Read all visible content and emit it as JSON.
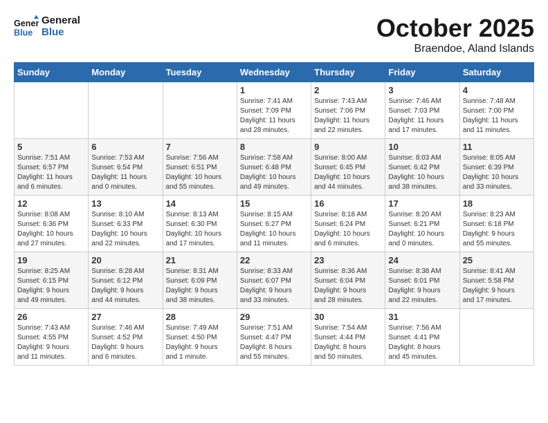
{
  "header": {
    "logo": {
      "line1": "General",
      "line2": "Blue"
    },
    "title": "October 2025",
    "location": "Braendoe, Aland Islands"
  },
  "days_of_week": [
    "Sunday",
    "Monday",
    "Tuesday",
    "Wednesday",
    "Thursday",
    "Friday",
    "Saturday"
  ],
  "weeks": [
    [
      {
        "day": "",
        "content": ""
      },
      {
        "day": "",
        "content": ""
      },
      {
        "day": "",
        "content": ""
      },
      {
        "day": "1",
        "content": "Sunrise: 7:41 AM\nSunset: 7:09 PM\nDaylight: 11 hours\nand 28 minutes."
      },
      {
        "day": "2",
        "content": "Sunrise: 7:43 AM\nSunset: 7:06 PM\nDaylight: 11 hours\nand 22 minutes."
      },
      {
        "day": "3",
        "content": "Sunrise: 7:46 AM\nSunset: 7:03 PM\nDaylight: 11 hours\nand 17 minutes."
      },
      {
        "day": "4",
        "content": "Sunrise: 7:48 AM\nSunset: 7:00 PM\nDaylight: 11 hours\nand 11 minutes."
      }
    ],
    [
      {
        "day": "5",
        "content": "Sunrise: 7:51 AM\nSunset: 6:57 PM\nDaylight: 11 hours\nand 6 minutes."
      },
      {
        "day": "6",
        "content": "Sunrise: 7:53 AM\nSunset: 6:54 PM\nDaylight: 11 hours\nand 0 minutes."
      },
      {
        "day": "7",
        "content": "Sunrise: 7:56 AM\nSunset: 6:51 PM\nDaylight: 10 hours\nand 55 minutes."
      },
      {
        "day": "8",
        "content": "Sunrise: 7:58 AM\nSunset: 6:48 PM\nDaylight: 10 hours\nand 49 minutes."
      },
      {
        "day": "9",
        "content": "Sunrise: 8:00 AM\nSunset: 6:45 PM\nDaylight: 10 hours\nand 44 minutes."
      },
      {
        "day": "10",
        "content": "Sunrise: 8:03 AM\nSunset: 6:42 PM\nDaylight: 10 hours\nand 38 minutes."
      },
      {
        "day": "11",
        "content": "Sunrise: 8:05 AM\nSunset: 6:39 PM\nDaylight: 10 hours\nand 33 minutes."
      }
    ],
    [
      {
        "day": "12",
        "content": "Sunrise: 8:08 AM\nSunset: 6:36 PM\nDaylight: 10 hours\nand 27 minutes."
      },
      {
        "day": "13",
        "content": "Sunrise: 8:10 AM\nSunset: 6:33 PM\nDaylight: 10 hours\nand 22 minutes."
      },
      {
        "day": "14",
        "content": "Sunrise: 8:13 AM\nSunset: 6:30 PM\nDaylight: 10 hours\nand 17 minutes."
      },
      {
        "day": "15",
        "content": "Sunrise: 8:15 AM\nSunset: 6:27 PM\nDaylight: 10 hours\nand 11 minutes."
      },
      {
        "day": "16",
        "content": "Sunrise: 8:18 AM\nSunset: 6:24 PM\nDaylight: 10 hours\nand 6 minutes."
      },
      {
        "day": "17",
        "content": "Sunrise: 8:20 AM\nSunset: 6:21 PM\nDaylight: 10 hours\nand 0 minutes."
      },
      {
        "day": "18",
        "content": "Sunrise: 8:23 AM\nSunset: 6:18 PM\nDaylight: 9 hours\nand 55 minutes."
      }
    ],
    [
      {
        "day": "19",
        "content": "Sunrise: 8:25 AM\nSunset: 6:15 PM\nDaylight: 9 hours\nand 49 minutes."
      },
      {
        "day": "20",
        "content": "Sunrise: 8:28 AM\nSunset: 6:12 PM\nDaylight: 9 hours\nand 44 minutes."
      },
      {
        "day": "21",
        "content": "Sunrise: 8:31 AM\nSunset: 6:09 PM\nDaylight: 9 hours\nand 38 minutes."
      },
      {
        "day": "22",
        "content": "Sunrise: 8:33 AM\nSunset: 6:07 PM\nDaylight: 9 hours\nand 33 minutes."
      },
      {
        "day": "23",
        "content": "Sunrise: 8:36 AM\nSunset: 6:04 PM\nDaylight: 9 hours\nand 28 minutes."
      },
      {
        "day": "24",
        "content": "Sunrise: 8:38 AM\nSunset: 6:01 PM\nDaylight: 9 hours\nand 22 minutes."
      },
      {
        "day": "25",
        "content": "Sunrise: 8:41 AM\nSunset: 5:58 PM\nDaylight: 9 hours\nand 17 minutes."
      }
    ],
    [
      {
        "day": "26",
        "content": "Sunrise: 7:43 AM\nSunset: 4:55 PM\nDaylight: 9 hours\nand 11 minutes."
      },
      {
        "day": "27",
        "content": "Sunrise: 7:46 AM\nSunset: 4:52 PM\nDaylight: 9 hours\nand 6 minutes."
      },
      {
        "day": "28",
        "content": "Sunrise: 7:49 AM\nSunset: 4:50 PM\nDaylight: 9 hours\nand 1 minute."
      },
      {
        "day": "29",
        "content": "Sunrise: 7:51 AM\nSunset: 4:47 PM\nDaylight: 8 hours\nand 55 minutes."
      },
      {
        "day": "30",
        "content": "Sunrise: 7:54 AM\nSunset: 4:44 PM\nDaylight: 8 hours\nand 50 minutes."
      },
      {
        "day": "31",
        "content": "Sunrise: 7:56 AM\nSunset: 4:41 PM\nDaylight: 8 hours\nand 45 minutes."
      },
      {
        "day": "",
        "content": ""
      }
    ]
  ]
}
